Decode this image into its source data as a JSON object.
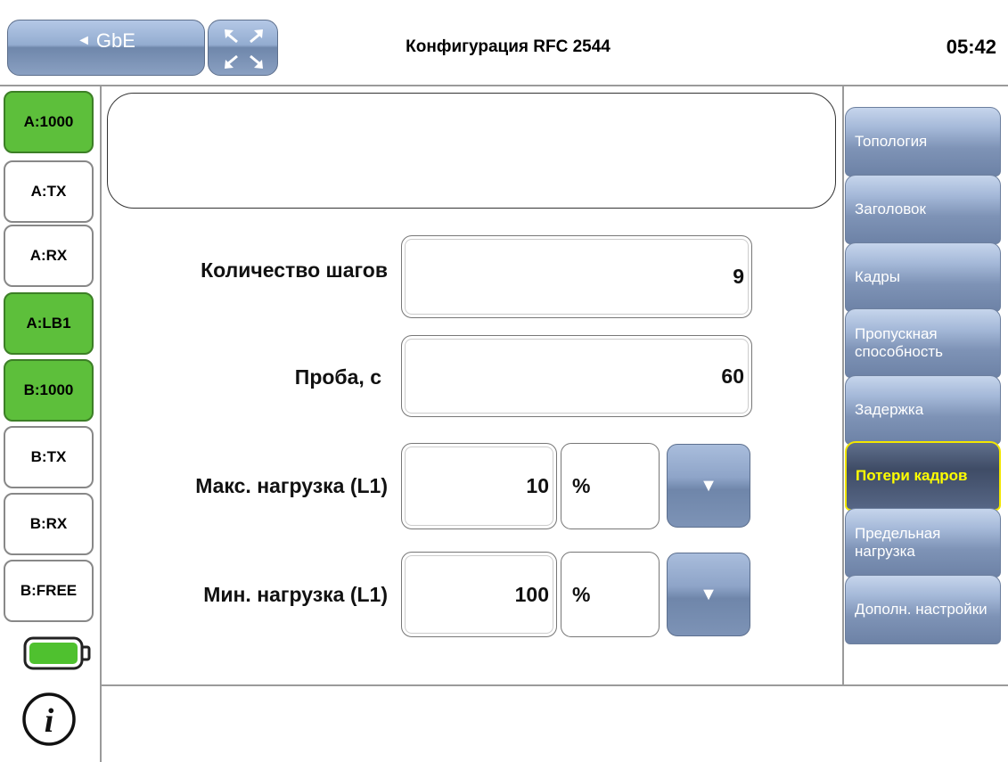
{
  "header": {
    "back_label": "GbE",
    "back_arrow": "◄",
    "title": "Конфигурация RFC 2544",
    "clock": "05:42"
  },
  "ports": [
    {
      "label": "A:1000",
      "active": true
    },
    {
      "label": "A:TX",
      "active": false
    },
    {
      "label": "A:RX",
      "active": false
    },
    {
      "label": "A:LB1",
      "active": true
    },
    {
      "label": "B:1000",
      "active": true
    },
    {
      "label": "B:TX",
      "active": false
    },
    {
      "label": "B:RX",
      "active": false
    },
    {
      "label": "B:FREE",
      "active": false
    }
  ],
  "tabs": [
    {
      "label": "Топология"
    },
    {
      "label": "Заголовок"
    },
    {
      "label": "Кадры"
    },
    {
      "label": "Пропускная способность"
    },
    {
      "label": "Задержка"
    },
    {
      "label": "Потери кадров",
      "active": true
    },
    {
      "label": "Предельная нагрузка"
    },
    {
      "label": "Дополн. настройки"
    }
  ],
  "form": {
    "steps_label": "Количество шагов",
    "steps_value": "9",
    "trial_label": "Проба, с",
    "trial_value": "60",
    "max_load_label": "Макс. нагрузка (L1)",
    "max_load_value": "10",
    "max_load_unit": "%",
    "min_load_label": "Мин. нагрузка (L1)",
    "min_load_value": "100",
    "min_load_unit": "%",
    "dropdown_glyph": "▼"
  },
  "icons": {
    "battery": "battery-icon",
    "info": "info-icon",
    "expand": "expand-icon"
  },
  "colors": {
    "port_active": "#5dbf3b",
    "tab_active_text": "#ffff00"
  }
}
